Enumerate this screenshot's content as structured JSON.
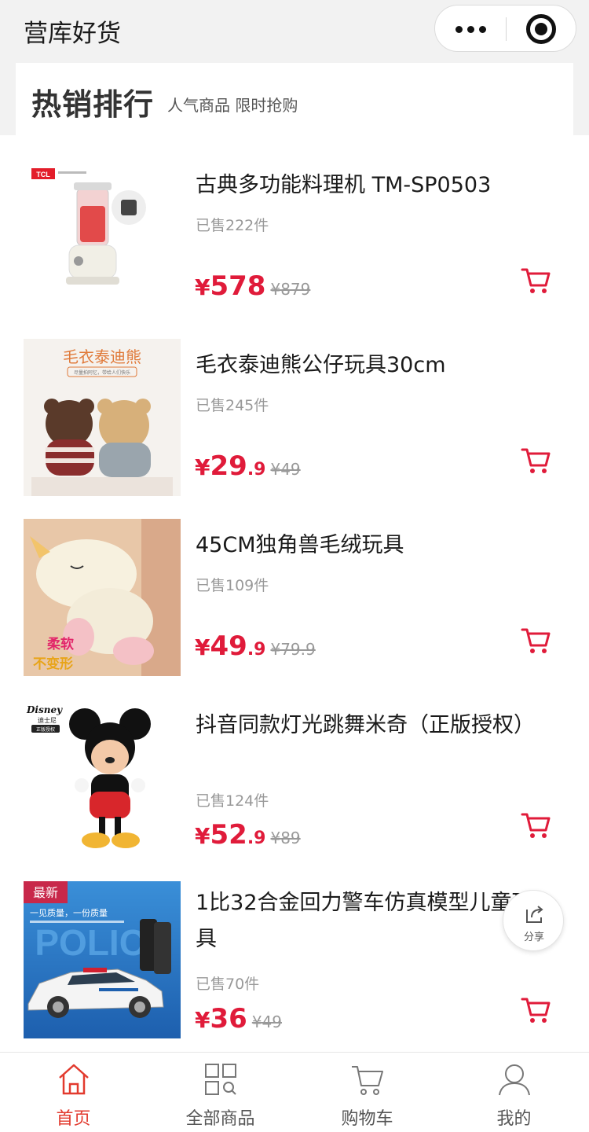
{
  "app_title": "营库好货",
  "section": {
    "title": "热销排行",
    "subtitle": "人气商品 限时抢购"
  },
  "products": [
    {
      "name": "古典多功能料理机 TM-SP0503",
      "sold": "已售222件",
      "currency": "¥",
      "price_int": "578",
      "price_dec": "",
      "orig_price": "¥879",
      "brand_mark": "TCL"
    },
    {
      "name": "毛衣泰迪熊公仔玩具30cm",
      "sold": "已售245件",
      "currency": "¥",
      "price_int": "29",
      "price_dec": ".9",
      "orig_price": "¥49",
      "image_text": "毛衣泰迪熊",
      "image_subtext": "尽量拍阿忆，带给人们快乐"
    },
    {
      "name": "45CM独角兽毛绒玩具",
      "sold": "已售109件",
      "currency": "¥",
      "price_int": "49",
      "price_dec": ".9",
      "orig_price": "¥79.9",
      "image_text_1": "柔软",
      "image_text_2": "不变形"
    },
    {
      "name": "抖音同款灯光跳舞米奇（正版授权）",
      "sold": "已售124件",
      "currency": "¥",
      "price_int": "52",
      "price_dec": ".9",
      "orig_price": "¥89",
      "brand_mark": "Disney",
      "brand_sub": "迪士尼",
      "brand_tag": "正版授权"
    },
    {
      "name": "1比32合金回力警车仿真模型儿童玩具",
      "sold": "已售70件",
      "currency": "¥",
      "price_int": "36",
      "price_dec": "",
      "orig_price": "¥49",
      "badge": "最新",
      "image_text": "一见质量，一份质量",
      "image_bg_word": "POLICE"
    }
  ],
  "share_label": "分享",
  "tabbar": [
    {
      "label": "首页",
      "icon": "home-icon",
      "active": true
    },
    {
      "label": "全部商品",
      "icon": "grid-search-icon",
      "active": false
    },
    {
      "label": "购物车",
      "icon": "cart-icon",
      "active": false
    },
    {
      "label": "我的",
      "icon": "user-icon",
      "active": false
    }
  ],
  "colors": {
    "accent": "#e01b3a",
    "tab_active": "#e23a2e",
    "muted": "#999999"
  }
}
